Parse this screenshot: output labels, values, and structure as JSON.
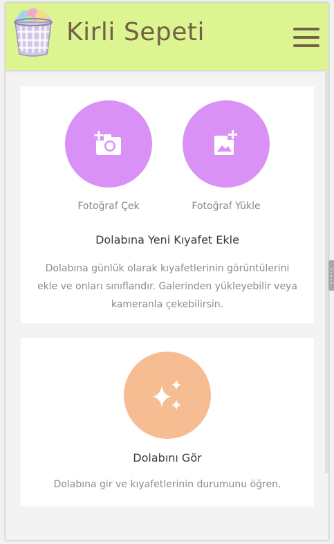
{
  "header": {
    "title": "Kirli Sepeti",
    "logo_icon": "laundry-basket-icon",
    "menu_icon": "hamburger-menu-icon",
    "background_color": "#dcf590",
    "title_color": "#74604a"
  },
  "add_card": {
    "take_photo_label": "Fotoğraf Çek",
    "upload_photo_label": "Fotoğraf Yükle",
    "take_photo_icon": "add-camera-icon",
    "upload_photo_icon": "add-image-icon",
    "button_color": "#d991f6",
    "title": "Dolabına Yeni Kıyafet Ekle",
    "description": "Dolabına günlük olarak kıyafetlerinin görüntülerini ekle ve onları sınıflandır. Galerinden yükleyebilir veya kameranla çekebilirsin."
  },
  "wardrobe_card": {
    "icon": "sparkles-icon",
    "button_color": "#f6bd92",
    "title": "Dolabını Gör",
    "description": "Dolabına gir ve kıyafetlerinin durumunu öğren."
  }
}
